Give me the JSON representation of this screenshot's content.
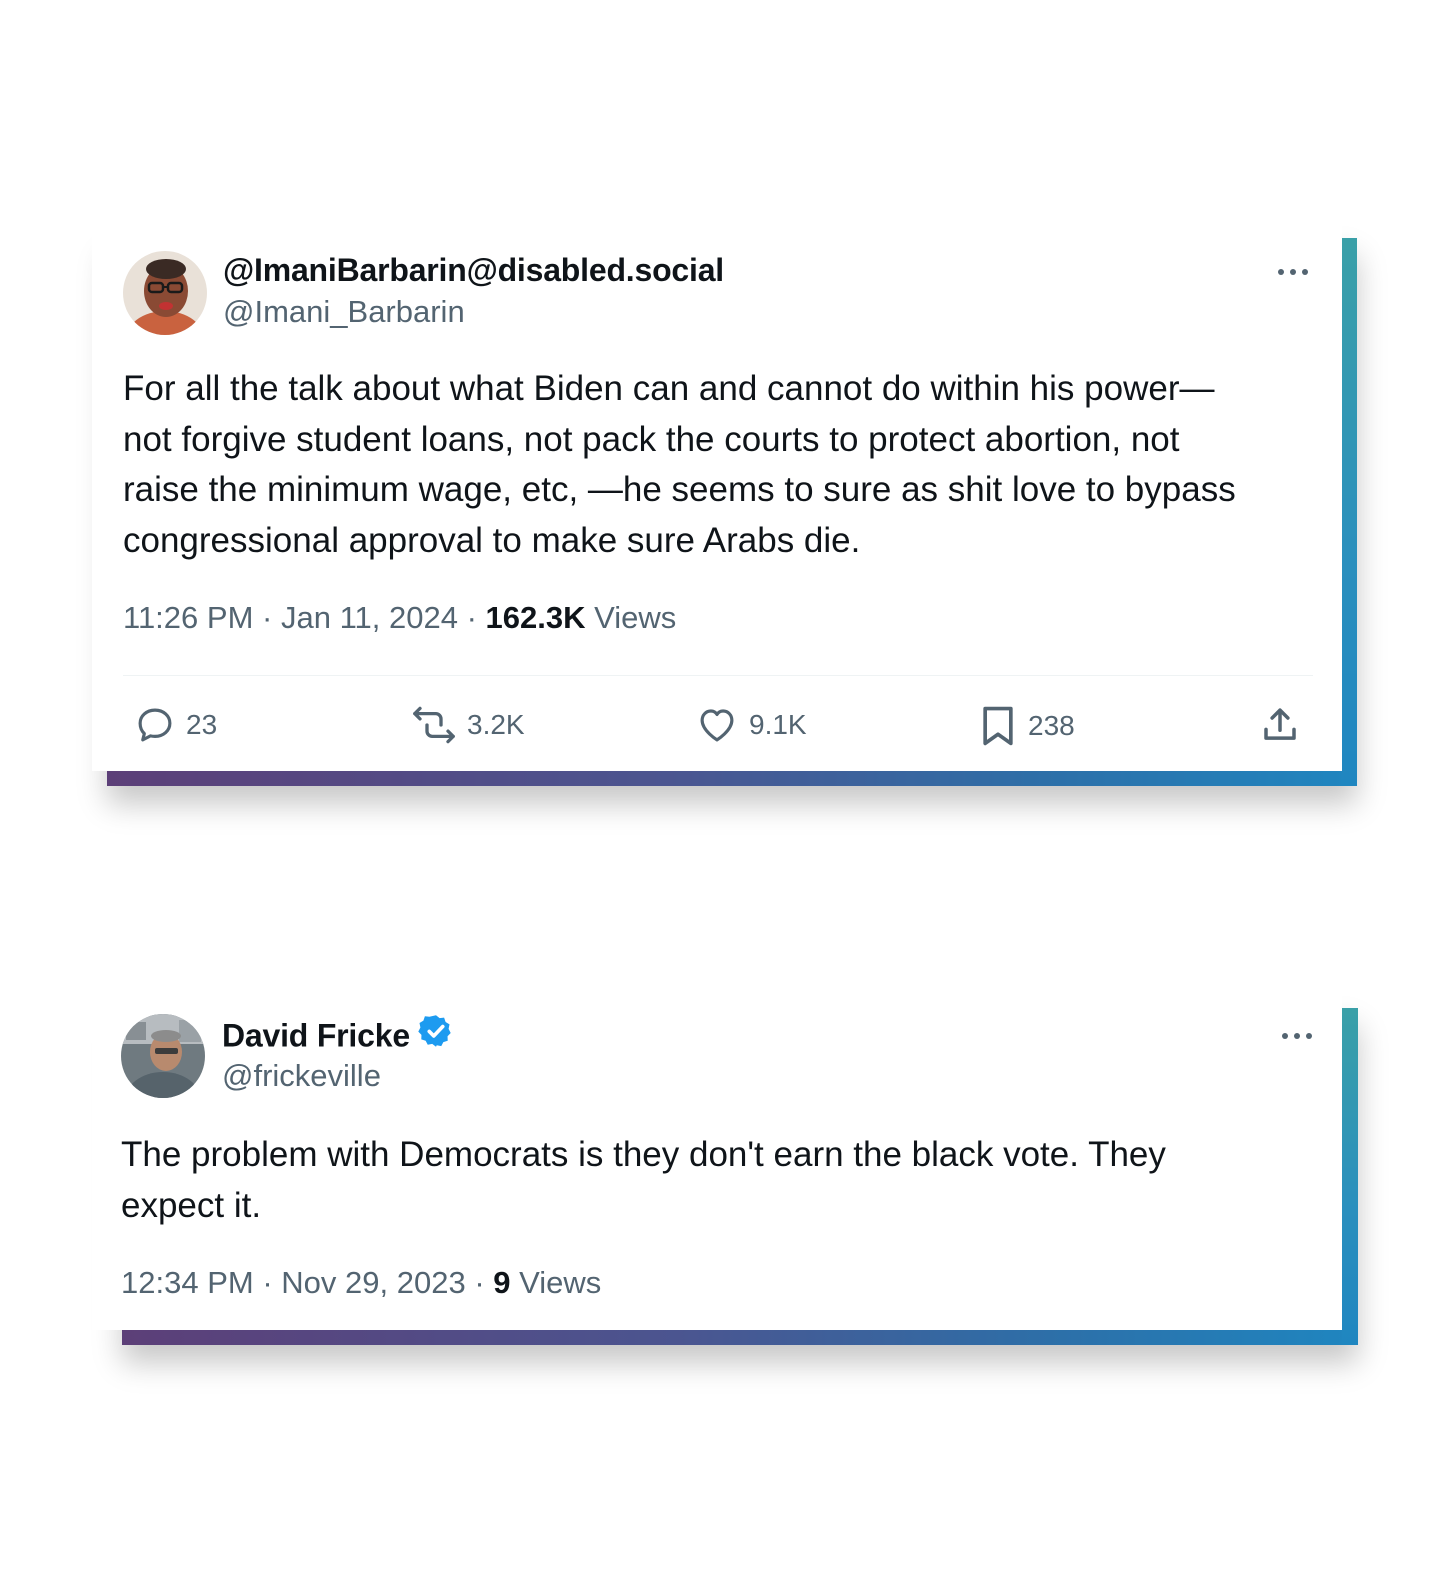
{
  "tweets": [
    {
      "display_name": "@ImaniBarbarin@disabled.social",
      "handle": "@Imani_Barbarin",
      "text": "For all the talk about what Biden can and cannot do within his power—\nnot forgive student loans, not pack the courts to protect abortion, not\nraise the minimum wage, etc, —he seems to sure as shit love to bypass\ncongressional approval to make sure Arabs die.",
      "time": "11:26 PM",
      "date": "Jan 11, 2024",
      "views_count": "162.3K",
      "views_label": "Views",
      "separator": "·",
      "actions": {
        "replies": "23",
        "reposts": "3.2K",
        "likes": "9.1K",
        "bookmarks": "238"
      },
      "icons": [
        "more-icon",
        "reply-icon",
        "repost-icon",
        "like-icon",
        "bookmark-icon",
        "share-icon"
      ]
    },
    {
      "display_name": "David Fricke",
      "handle": "@frickeville",
      "verified": true,
      "text": "The problem with Democrats is they don't earn the black vote. They\nexpect it.",
      "time": "12:34 PM",
      "date": "Nov 29, 2023",
      "views_count": "9",
      "views_label": "Views",
      "separator": "·",
      "icons": [
        "more-icon",
        "verified-badge-icon"
      ]
    }
  ],
  "colors": {
    "text_primary": "#0f1419",
    "text_secondary": "#536471",
    "verified_blue": "#1d9bf0",
    "frame_gradient_start": "#5c3f78",
    "frame_gradient_end": "#1f86c0"
  }
}
